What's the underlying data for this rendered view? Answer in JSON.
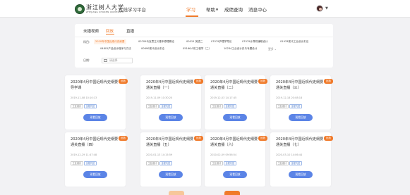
{
  "header": {
    "logo_text": "浙江树人大学",
    "logo_sub": "ZHEJIANG SHUREN UNIVERSITY",
    "platform": "在线学习平台",
    "nav": [
      {
        "label": "学习",
        "active": true
      },
      {
        "label": "帮助",
        "active": false,
        "has_caret": true
      },
      {
        "label": "成绩查询",
        "active": false
      },
      {
        "label": "消息中心",
        "active": false
      }
    ],
    "accent": "#f07a2a"
  },
  "filter": {
    "tabs": [
      {
        "label": "未播视频",
        "active": false
      },
      {
        "label": "回放",
        "active": true
      },
      {
        "label": "直播",
        "active": false
      }
    ],
    "subject_label": "科目:",
    "subjects_row1": [
      "2020年中国近现代史纲要",
      "00709马克思主义基本原理概论",
      "00015 英语二",
      "07079护理学导论",
      "07079计算机辅助设计",
      "01933现代工业设计史论"
    ],
    "subjects_row2": [
      "04801产品设计程序与方法",
      "00690现代设计史论",
      "05166人机工程学（二）",
      "10234工业设计史与专题设计"
    ],
    "more_label": "更多 ⌄",
    "date_label": "日期:",
    "date_placeholder": "请选择"
  },
  "cards": [
    {
      "title": "2020年4月中国近现代史纲要导学课",
      "date": "2019-11-08 10:10:13",
      "badge": "回放"
    },
    {
      "title": "2020年4月中国近现代史纲要通关直播（一）",
      "date": "2019-11-09 10:30:20",
      "badge": "回放"
    },
    {
      "title": "2020年4月中国近现代史纲要通关直播（二）",
      "date": "2019-12-03 14:17:45",
      "badge": "回放"
    },
    {
      "title": "2020年4月中国近现代史纲要通关直播（三）",
      "date": "2019-12-18 20:08:18",
      "badge": "回放"
    },
    {
      "title": "2020年4月中国近现代史纲要通关直播（四）",
      "date": "2019-12-29 11:47:48",
      "badge": "回放"
    },
    {
      "title": "2020年4月中国近现代史纲要通关直播（五）",
      "date": "2020-01-13 14:15:59",
      "badge": "回放"
    },
    {
      "title": "2020年4月中国近现代史纲要通关直播（六）",
      "date": "2020-02-09 09:56:54",
      "badge": "回放"
    },
    {
      "title": "2020年4月中国近现代史纲要通关直播（七）",
      "date": "2020-03-10 14:06:44",
      "badge": "回放"
    }
  ],
  "card_tags": {
    "major": "工业设计",
    "type": "全程代班"
  },
  "card_button": "观看回放",
  "colors": {
    "badge": "#f07a2a",
    "button": "#5b84e6",
    "page_btn": "#f7c79a"
  }
}
